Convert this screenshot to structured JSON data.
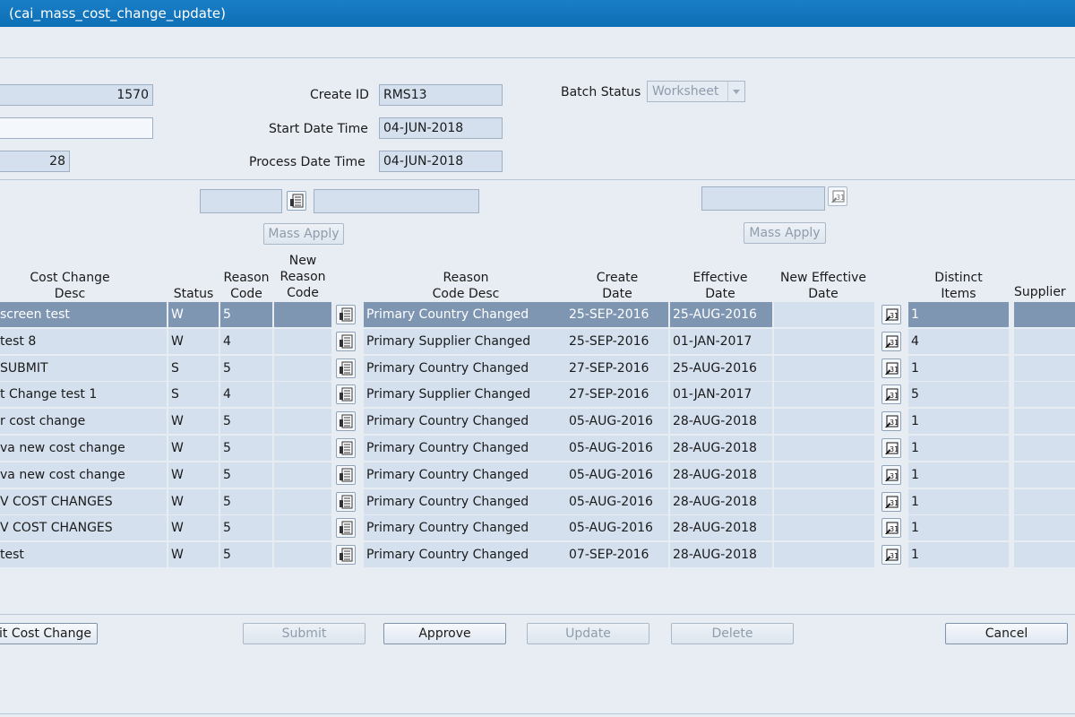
{
  "window": {
    "title": "(cai_mass_cost_change_update)"
  },
  "header": {
    "batch_no": "1570",
    "description": "",
    "total_items": "28",
    "create_id_label": "Create ID",
    "create_id": "RMS13",
    "start_date_label": "Start Date Time",
    "start_date": "04-JUN-2018",
    "process_date_label": "Process Date Time",
    "process_date": "04-JUN-2018",
    "batch_status_label": "Batch Status",
    "batch_status": "Worksheet"
  },
  "mass_apply": {
    "reason_code": "",
    "reason_desc": "",
    "new_effective_date": "",
    "left_button": "Mass Apply",
    "right_button": "Mass Apply"
  },
  "table": {
    "headers": {
      "cost_change_desc": [
        "Cost Change",
        "Desc"
      ],
      "status": [
        "Status"
      ],
      "reason_code": [
        "Reason",
        "Code"
      ],
      "new_reason_code": [
        "New",
        "Reason",
        "Code"
      ],
      "reason_code_desc": [
        "Reason",
        "Code Desc"
      ],
      "create_date": [
        "Create",
        "Date"
      ],
      "effective_date": [
        "Effective",
        "Date"
      ],
      "new_effective_date": [
        "New Effective",
        "Date"
      ],
      "distinct_items": [
        "Distinct",
        "Items"
      ],
      "supplier": [
        "Supplier"
      ]
    },
    "rows": [
      {
        "desc": "screen test",
        "status": "W",
        "reason": "5",
        "new_reason": "",
        "reason_desc": "Primary Country Changed",
        "create": "25-SEP-2016",
        "effective": "25-AUG-2016",
        "new_effective": "",
        "items": "1",
        "supplier": ""
      },
      {
        "desc": "test 8",
        "status": "W",
        "reason": "4",
        "new_reason": "",
        "reason_desc": "Primary Supplier Changed",
        "create": "25-SEP-2016",
        "effective": "01-JAN-2017",
        "new_effective": "",
        "items": "4",
        "supplier": ""
      },
      {
        "desc": " SUBMIT",
        "status": "S",
        "reason": "5",
        "new_reason": "",
        "reason_desc": "Primary Country Changed",
        "create": "27-SEP-2016",
        "effective": "25-AUG-2016",
        "new_effective": "",
        "items": "1",
        "supplier": ""
      },
      {
        "desc": "t Change test 1",
        "status": "S",
        "reason": "4",
        "new_reason": "",
        "reason_desc": "Primary Supplier Changed",
        "create": "27-SEP-2016",
        "effective": "01-JAN-2017",
        "new_effective": "",
        "items": "5",
        "supplier": ""
      },
      {
        "desc": "r cost change",
        "status": "W",
        "reason": "5",
        "new_reason": "",
        "reason_desc": "Primary Country Changed",
        "create": "05-AUG-2016",
        "effective": "28-AUG-2018",
        "new_effective": "",
        "items": "1",
        "supplier": ""
      },
      {
        "desc": "va new cost change",
        "status": "W",
        "reason": "5",
        "new_reason": "",
        "reason_desc": "Primary Country Changed",
        "create": "05-AUG-2016",
        "effective": "28-AUG-2018",
        "new_effective": "",
        "items": "1",
        "supplier": ""
      },
      {
        "desc": "va new cost change",
        "status": "W",
        "reason": "5",
        "new_reason": "",
        "reason_desc": "Primary Country Changed",
        "create": "05-AUG-2016",
        "effective": "28-AUG-2018",
        "new_effective": "",
        "items": "1",
        "supplier": ""
      },
      {
        "desc": "V COST CHANGES",
        "status": "W",
        "reason": "5",
        "new_reason": "",
        "reason_desc": "Primary Country Changed",
        "create": "05-AUG-2016",
        "effective": "28-AUG-2018",
        "new_effective": "",
        "items": "1",
        "supplier": ""
      },
      {
        "desc": "V COST CHANGES",
        "status": "W",
        "reason": "5",
        "new_reason": "",
        "reason_desc": "Primary Country Changed",
        "create": "05-AUG-2016",
        "effective": "28-AUG-2018",
        "new_effective": "",
        "items": "1",
        "supplier": ""
      },
      {
        "desc": "test",
        "status": "W",
        "reason": "5",
        "new_reason": "",
        "reason_desc": "Primary Country Changed",
        "create": "07-SEP-2016",
        "effective": "28-AUG-2018",
        "new_effective": "",
        "items": "1",
        "supplier": ""
      }
    ]
  },
  "buttons": {
    "edit_cost_change": "it Cost Change",
    "submit": "Submit",
    "approve": "Approve",
    "update": "Update",
    "delete": "Delete",
    "cancel": "Cancel"
  }
}
